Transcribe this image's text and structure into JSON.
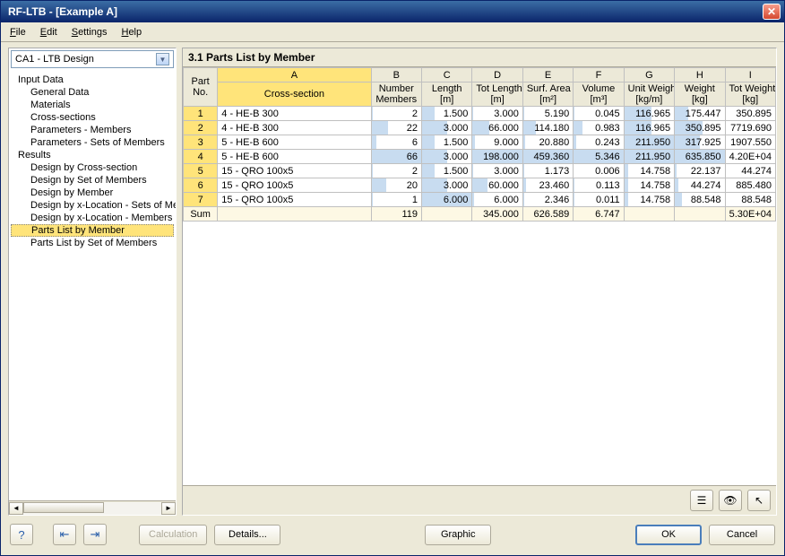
{
  "window": {
    "title": "RF-LTB - [Example A]"
  },
  "menu": {
    "file": "File",
    "edit": "Edit",
    "settings": "Settings",
    "help": "Help"
  },
  "combo": {
    "value": "CA1 - LTB Design"
  },
  "tree": {
    "input_data": "Input Data",
    "general_data": "General Data",
    "materials": "Materials",
    "cross_sections": "Cross-sections",
    "params_members": "Parameters - Members",
    "params_sets": "Parameters - Sets of Members",
    "results": "Results",
    "design_cs": "Design by Cross-section",
    "design_set": "Design by Set of Members",
    "design_member": "Design by Member",
    "design_xloc_sets": "Design by x-Location - Sets of Members",
    "design_xloc_members": "Design by x-Location - Members",
    "parts_member": "Parts List by Member",
    "parts_set": "Parts List by Set of Members"
  },
  "panel": {
    "title": "3.1 Parts List by Member"
  },
  "grid": {
    "col_letters": [
      "A",
      "B",
      "C",
      "D",
      "E",
      "F",
      "G",
      "H",
      "I"
    ],
    "head_part": "Part\nNo.",
    "headers": [
      "Cross-section",
      "Number\nMembers",
      "Length\n[m]",
      "Tot Length\n[m]",
      "Surf. Area\n[m²]",
      "Volume\n[m³]",
      "Unit Weight\n[kg/m]",
      "Weight\n[kg]",
      "Tot Weight\n[kg]"
    ],
    "rows": [
      {
        "n": "1",
        "cs": "4 - HE-B 300",
        "num": "2",
        "len": "1.500",
        "tot": "3.000",
        "area": "5.190",
        "vol": "0.045",
        "uw": "116.965",
        "w": "175.447",
        "tw": "350.895"
      },
      {
        "n": "2",
        "cs": "4 - HE-B 300",
        "num": "22",
        "len": "3.000",
        "tot": "66.000",
        "area": "114.180",
        "vol": "0.983",
        "uw": "116.965",
        "w": "350.895",
        "tw": "7719.690"
      },
      {
        "n": "3",
        "cs": "5 - HE-B 600",
        "num": "6",
        "len": "1.500",
        "tot": "9.000",
        "area": "20.880",
        "vol": "0.243",
        "uw": "211.950",
        "w": "317.925",
        "tw": "1907.550"
      },
      {
        "n": "4",
        "cs": "5 - HE-B 600",
        "num": "66",
        "len": "3.000",
        "tot": "198.000",
        "area": "459.360",
        "vol": "5.346",
        "uw": "211.950",
        "w": "635.850",
        "tw": "4.20E+04"
      },
      {
        "n": "5",
        "cs": "15 - QRO 100x5",
        "num": "2",
        "len": "1.500",
        "tot": "3.000",
        "area": "1.173",
        "vol": "0.006",
        "uw": "14.758",
        "w": "22.137",
        "tw": "44.274"
      },
      {
        "n": "6",
        "cs": "15 - QRO 100x5",
        "num": "20",
        "len": "3.000",
        "tot": "60.000",
        "area": "23.460",
        "vol": "0.113",
        "uw": "14.758",
        "w": "44.274",
        "tw": "885.480"
      },
      {
        "n": "7",
        "cs": "15 - QRO 100x5",
        "num": "1",
        "len": "6.000",
        "tot": "6.000",
        "area": "2.346",
        "vol": "0.011",
        "uw": "14.758",
        "w": "88.548",
        "tw": "88.548"
      }
    ],
    "sum_label": "Sum",
    "sum": {
      "num": "119",
      "len": "",
      "tot": "345.000",
      "area": "626.589",
      "vol": "6.747",
      "uw": "",
      "w": "",
      "tw": "5.30E+04"
    },
    "bar_max": {
      "num": 66,
      "len": 6.0,
      "tot": 198.0,
      "area": 459.36,
      "vol": 5.346,
      "uw": 211.95,
      "w": 635.85
    }
  },
  "buttons": {
    "calculation": "Calculation",
    "details": "Details...",
    "graphic": "Graphic",
    "ok": "OK",
    "cancel": "Cancel"
  }
}
